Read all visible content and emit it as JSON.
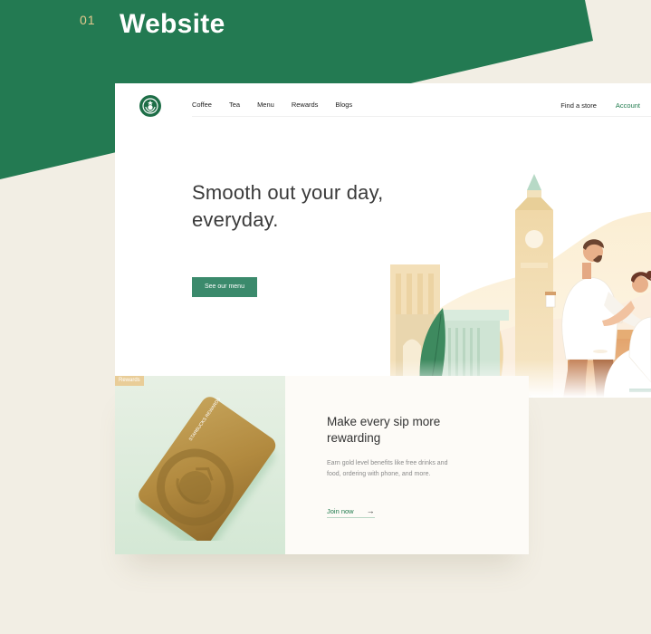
{
  "section": {
    "number": "01",
    "title": "Website"
  },
  "nav": {
    "logo": "starbucks-siren-logo",
    "links": [
      "Coffee",
      "Tea",
      "Menu",
      "Rewards",
      "Blogs"
    ],
    "find_store": "Find a store",
    "account": "Account"
  },
  "hero": {
    "title_line1": "Smooth out your day,",
    "title_line2": "everyday.",
    "cta": "See our menu"
  },
  "rewards": {
    "tag": "Rewards",
    "card_brand": "STARBUCKS REWARDS",
    "title_line1": "Make every sip more",
    "title_line2": "rewarding",
    "desc_line1": "Earn gold level benefits like free drinks and",
    "desc_line2": "food, ordering with phone, and more.",
    "join": "Join now",
    "join_icon": "arrow-right-icon"
  },
  "colors": {
    "brand_green": "#1e7a4c",
    "button_green": "#3b8a6c",
    "gold": "#e9cd98",
    "background": "#f2eee4"
  }
}
